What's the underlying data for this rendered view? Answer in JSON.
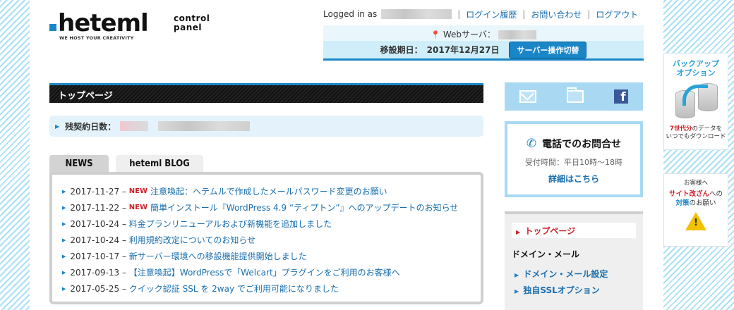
{
  "logo": {
    "name": "heteml",
    "tagline": "WE HOST YOUR CREATIVITY",
    "subtitle_line1": "control",
    "subtitle_line2": "panel"
  },
  "header": {
    "logged_in_label": "Logged in as",
    "links": [
      "ログイン履歴",
      "お問い合わせ",
      "ログアウト"
    ],
    "separator": "|"
  },
  "server": {
    "web_server_label": "Webサーバ：",
    "migration_label": "移設期日：",
    "migration_date": "2017年12月27日",
    "switch_button": "サーバー操作切替"
  },
  "main": {
    "page_title": "トップページ",
    "contract_label": "残契約日数：",
    "tabs": [
      "NEWS",
      "heteml BLOG"
    ],
    "news": [
      {
        "date": "2017-11-27 –",
        "new": "NEW",
        "text": "注意喚起：ヘテムルで作成したメールパスワード変更のお願い"
      },
      {
        "date": "2017-11-22 –",
        "new": "NEW",
        "text": "簡単インストール『WordPress 4.9 “ティプトン”』へのアップデートのお知らせ"
      },
      {
        "date": "2017-10-24 –",
        "new": "",
        "text": "料金プランリニューアルおよび新機能を追加しました"
      },
      {
        "date": "2017-10-24 –",
        "new": "",
        "text": "利用規約改定についてのお知らせ"
      },
      {
        "date": "2017-10-17 –",
        "new": "",
        "text": "新サーバー環境への移設機能提供開始しました"
      },
      {
        "date": "2017-09-13 –",
        "new": "",
        "text": "【注意喚起】WordPressで「Welcart」プラグインをご利用のお客様へ"
      },
      {
        "date": "2017-05-25 –",
        "new": "",
        "text": "クイック認証 SSL を 2way でご利用可能になりました"
      }
    ]
  },
  "sidebar": {
    "icons": [
      "mail-icon",
      "folder-icon",
      "facebook-icon"
    ],
    "facebook_letter": "f",
    "contact": {
      "title": "電話でのお問合せ",
      "hours": "受付時間：平日10時〜18時",
      "link": "詳細はこちら"
    },
    "menu": {
      "active": "トップページ",
      "category": "ドメイン・メール",
      "items": [
        "ドメイン・メール設定",
        "独自SSLオプション"
      ]
    }
  },
  "banners": {
    "backup": {
      "title_line1": "バックアップ",
      "title_line2": "オプション",
      "text_red": "7世代分",
      "text_rest1": "のデータを",
      "text_line2": "いつでもダウンロード"
    },
    "request": {
      "small": "お客様へ",
      "red": "サイト改ざん",
      "mid": "への",
      "blue": "対策",
      "end": "のお願い",
      "warn_mark": "!"
    }
  },
  "colors": {
    "accent": "#1a86c8",
    "new_badge": "#d0202a",
    "link": "#1a6fb0"
  }
}
